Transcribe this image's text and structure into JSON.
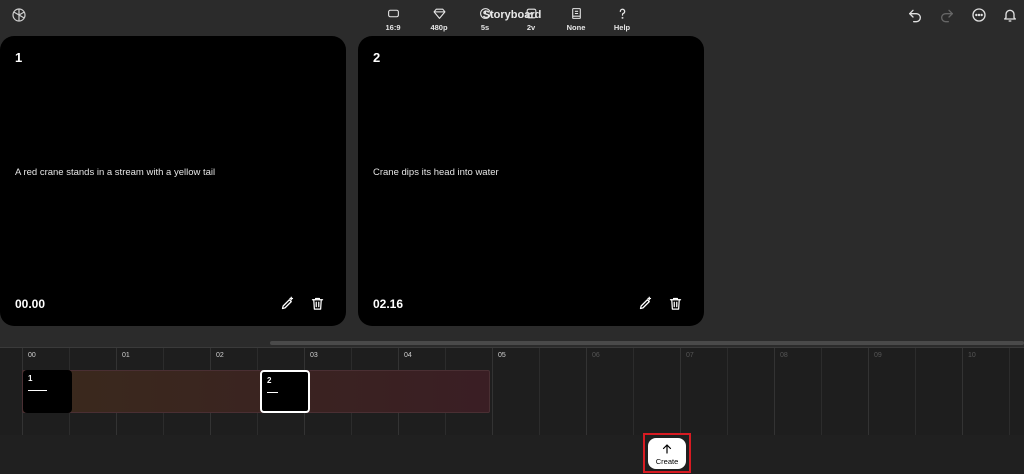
{
  "app": {
    "title": "Storyboard",
    "icons": {
      "logo": "openai-logo-icon",
      "undo": "undo-icon",
      "redo": "redo-icon",
      "more": "more-options-icon",
      "notifications": "bell-icon"
    }
  },
  "cards": [
    {
      "number": "1",
      "prompt": "A red crane stands in a stream with a yellow tail",
      "time": "00.00"
    },
    {
      "number": "2",
      "prompt": "Crane dips its head into water",
      "time": "02.16"
    }
  ],
  "timeline": {
    "labels": [
      "00",
      "01",
      "02",
      "03",
      "04",
      "05",
      "06",
      "07",
      "08",
      "09",
      "10"
    ],
    "clips": [
      {
        "number": "1",
        "selected": false
      },
      {
        "number": "2",
        "selected": true
      }
    ]
  },
  "toolbar": {
    "tools": [
      {
        "label": "16:9",
        "icon": "aspect-ratio-icon"
      },
      {
        "label": "480p",
        "icon": "diamond-icon"
      },
      {
        "label": "5s",
        "icon": "clock-icon"
      },
      {
        "label": "2v",
        "icon": "variations-icon"
      },
      {
        "label": "None",
        "icon": "book-icon"
      },
      {
        "label": "Help",
        "icon": "question-icon"
      }
    ],
    "create_label": "Create"
  },
  "colors": {
    "background": "#2b2b2b",
    "card": "#000000",
    "highlight_frame": "#d81b22"
  }
}
